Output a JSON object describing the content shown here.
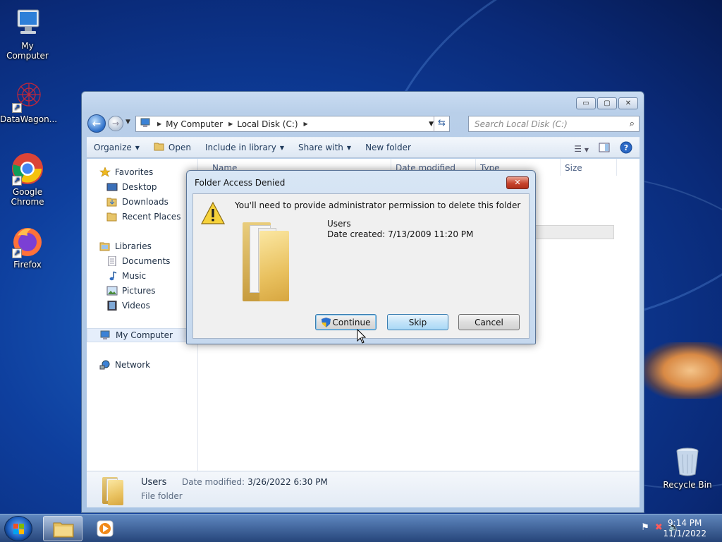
{
  "desktop": {
    "icons": [
      {
        "label": "My Computer"
      },
      {
        "label": "DataWagon..."
      },
      {
        "label": "Google Chrome"
      },
      {
        "label": "Firefox"
      },
      {
        "label": "Recycle Bin"
      }
    ]
  },
  "explorer": {
    "window_buttons": {
      "minimize": "▭",
      "maximize": "▢",
      "close": "✕"
    },
    "address": {
      "crumbs": [
        "My Computer",
        "Local Disk (C:)"
      ]
    },
    "search": {
      "placeholder": "Search Local Disk (C:)"
    },
    "toolbar": {
      "organize": "Organize",
      "open": "Open",
      "include_in_library": "Include in library",
      "share_with": "Share with",
      "new_folder": "New folder"
    },
    "columns": [
      "Name",
      "Date modified",
      "Type",
      "Size"
    ],
    "nav": {
      "favorites": "Favorites",
      "desktop": "Desktop",
      "downloads": "Downloads",
      "recent_places": "Recent Places",
      "libraries": "Libraries",
      "documents": "Documents",
      "music": "Music",
      "pictures": "Pictures",
      "videos": "Videos",
      "my_computer": "My Computer",
      "network": "Network"
    },
    "details": {
      "name": "Users",
      "kind": "File folder",
      "modified_label": "Date modified:",
      "modified_value": "3/26/2022 6:30 PM"
    }
  },
  "dialog": {
    "title": "Folder Access Denied",
    "message": "You'll need to provide administrator permission to delete this folder",
    "item_name": "Users",
    "date_created": "Date created: 7/13/2009 11:20 PM",
    "buttons": {
      "continue": "Continue",
      "skip": "Skip",
      "cancel": "Cancel"
    }
  },
  "taskbar": {
    "time": "9:14 PM",
    "date": "11/1/2022"
  }
}
